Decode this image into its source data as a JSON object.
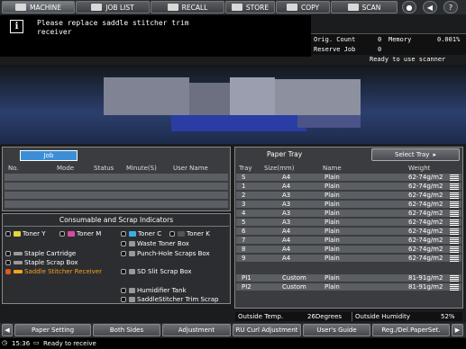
{
  "tabs": [
    {
      "label": "MACHINE",
      "icon": "machine-icon"
    },
    {
      "label": "JOB LIST",
      "icon": "job-list-icon"
    },
    {
      "label": "RECALL",
      "icon": "recall-icon"
    },
    {
      "label": "STORE",
      "icon": "store-icon"
    },
    {
      "label": "COPY",
      "icon": "copy-icon"
    },
    {
      "label": "SCAN",
      "icon": "scan-icon"
    }
  ],
  "message": "Please replace saddle stitcher trim receiver",
  "counts": {
    "orig_count_label": "Orig. Count",
    "orig_count": "0",
    "memory_label": "Memory",
    "memory": "0.001%",
    "reserve_label": "Reserve Job",
    "reserve": "0"
  },
  "ready_scanner": "Ready to use scanner",
  "job": {
    "tab": "Job",
    "headers": [
      "No.",
      "Mode",
      "Status",
      "Minute(S)",
      "User Name"
    ]
  },
  "consumables": {
    "title": "Consumable and Scrap Indicators",
    "items": {
      "toner_y": "Toner Y",
      "toner_m": "Toner M",
      "toner_c": "Toner C",
      "toner_k": "Toner K",
      "waste_toner": "Waste Toner Box",
      "staple_cartridge": "Staple Cartridge",
      "punch_hole": "Punch-Hole Scraps Box",
      "staple_scrap": "Staple Scrap Box",
      "saddle_receiver": "Saddle Stitcher Receiver",
      "sd_slit": "SD Slit Scrap Box",
      "humidifier": "Humidifier Tank",
      "saddle_trim": "SaddleStitcher Trim Scrap"
    },
    "warning_color": "#f7a21b"
  },
  "tray": {
    "title": "Paper Tray",
    "select_label": "Select Tray",
    "headers": [
      "Tray",
      "Size(mm)",
      "Name",
      "Weight"
    ],
    "rows": [
      {
        "tray": "S",
        "size": "A4",
        "name": "Plain",
        "weight": "62-74g/m2"
      },
      {
        "tray": "1",
        "size": "A4",
        "name": "Plain",
        "weight": "62-74g/m2"
      },
      {
        "tray": "2",
        "size": "A3",
        "name": "Plain",
        "weight": "62-74g/m2"
      },
      {
        "tray": "3",
        "size": "A3",
        "name": "Plain",
        "weight": "62-74g/m2"
      },
      {
        "tray": "4",
        "size": "A3",
        "name": "Plain",
        "weight": "62-74g/m2"
      },
      {
        "tray": "5",
        "size": "A3",
        "name": "Plain",
        "weight": "62-74g/m2"
      },
      {
        "tray": "6",
        "size": "A4",
        "name": "Plain",
        "weight": "62-74g/m2"
      },
      {
        "tray": "7",
        "size": "A4",
        "name": "Plain",
        "weight": "62-74g/m2"
      },
      {
        "tray": "8",
        "size": "A4",
        "name": "Plain",
        "weight": "62-74g/m2"
      },
      {
        "tray": "9",
        "size": "A4",
        "name": "Plain",
        "weight": "62-74g/m2"
      },
      {
        "tray": "PI1",
        "size": "Custom",
        "name": "Plain",
        "weight": "81-91g/m2"
      },
      {
        "tray": "PI2",
        "size": "Custom",
        "name": "Plain",
        "weight": "81-91g/m2"
      }
    ],
    "outside_temp_label": "Outside Temp.",
    "outside_temp": "26Degrees",
    "outside_hum_label": "Outside Humidity",
    "outside_hum": "52%"
  },
  "bottom_tabs": [
    "Paper Setting",
    "Both Sides",
    "Adjustment",
    "RU Curl Adjustment",
    "User's Guide",
    "Reg./Del.PaperSet."
  ],
  "status": {
    "time": "15:36",
    "text": "Ready to receive"
  }
}
